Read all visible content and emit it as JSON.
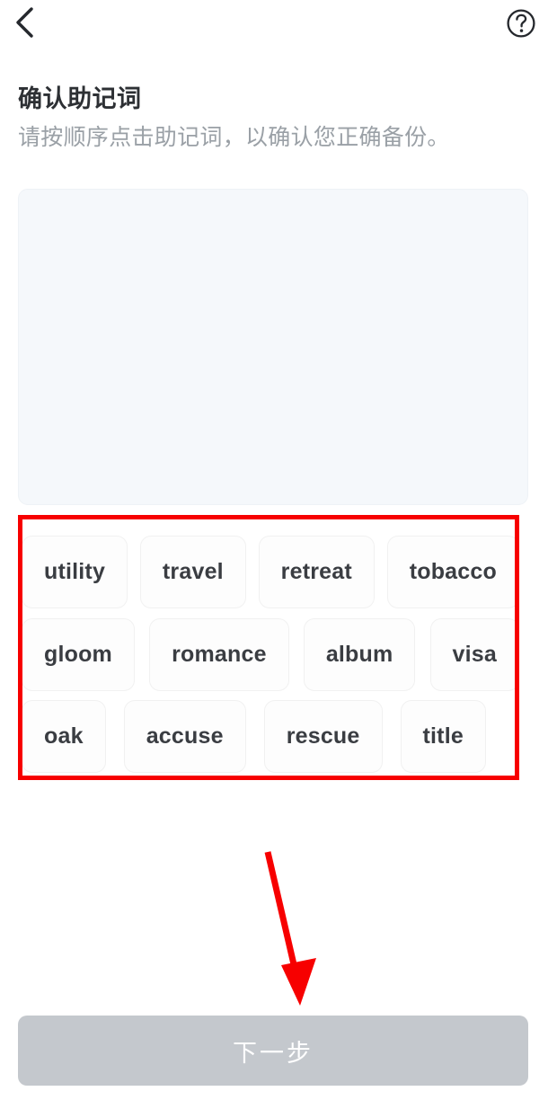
{
  "topbar": {
    "back_icon": "chevron-left-icon",
    "help_icon": "question-circle-icon"
  },
  "header": {
    "title": "确认助记词",
    "subtitle": "请按顺序点击助记词，以确认您正确备份。"
  },
  "selection_panel": {
    "selected_words": [],
    "background_color": "#f5f8fb"
  },
  "word_bank": {
    "highlight_color": "#f70000",
    "rows": [
      {
        "align": "spread",
        "words": [
          "utility",
          "travel",
          "retreat",
          "tobacco"
        ]
      },
      {
        "align": "spread",
        "words": [
          "gloom",
          "romance",
          "album",
          "visa"
        ]
      },
      {
        "align": "packed",
        "words": [
          "oak",
          "accuse",
          "rescue",
          "title"
        ]
      }
    ]
  },
  "annotation": {
    "arrow_color": "#f70000",
    "arrow_from": "298,948",
    "arrow_to": "335,1116"
  },
  "footer": {
    "next_label": "下一步",
    "next_enabled": false,
    "disabled_color": "#c4c8cd"
  }
}
